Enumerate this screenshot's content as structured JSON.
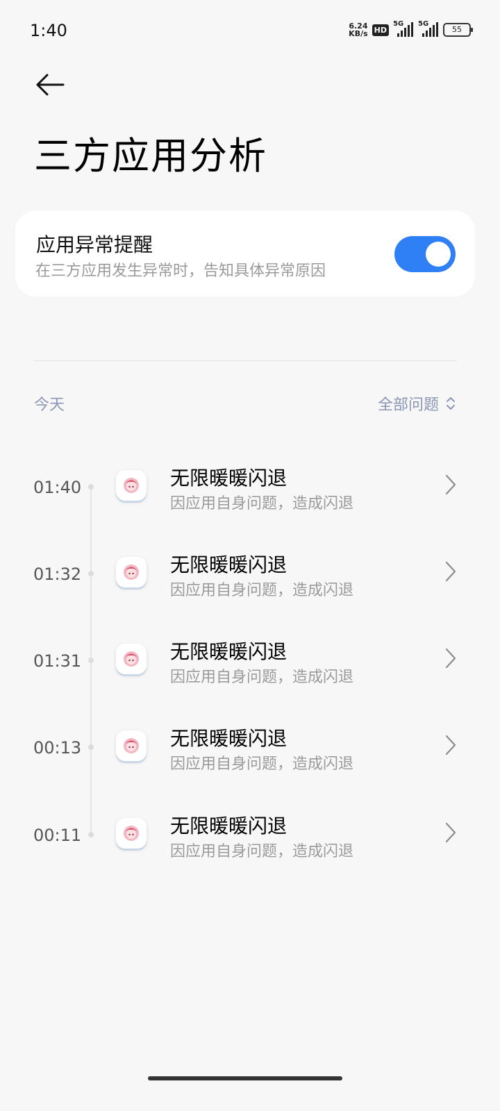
{
  "status_bar": {
    "time": "1:40",
    "net_speed_value": "6.24",
    "net_speed_unit": "KB/s",
    "hd_label": "HD",
    "sim1_label": "5G",
    "sim2_label": "5G",
    "battery": "55"
  },
  "header": {
    "title": "三方应用分析"
  },
  "alert_setting": {
    "title": "应用异常提醒",
    "description": "在三方应用发生异常时，告知具体异常原因",
    "enabled": true,
    "accent_color": "#2f7ff5"
  },
  "list": {
    "date_label": "今天",
    "filter_label": "全部问题",
    "items": [
      {
        "time": "01:40",
        "title": "无限暖暖闪退",
        "reason": "因应用自身问题，造成闪退"
      },
      {
        "time": "01:32",
        "title": "无限暖暖闪退",
        "reason": "因应用自身问题，造成闪退"
      },
      {
        "time": "01:31",
        "title": "无限暖暖闪退",
        "reason": "因应用自身问题，造成闪退"
      },
      {
        "time": "00:13",
        "title": "无限暖暖闪退",
        "reason": "因应用自身问题，造成闪退"
      },
      {
        "time": "00:11",
        "title": "无限暖暖闪退",
        "reason": "因应用自身问题，造成闪退"
      }
    ]
  }
}
